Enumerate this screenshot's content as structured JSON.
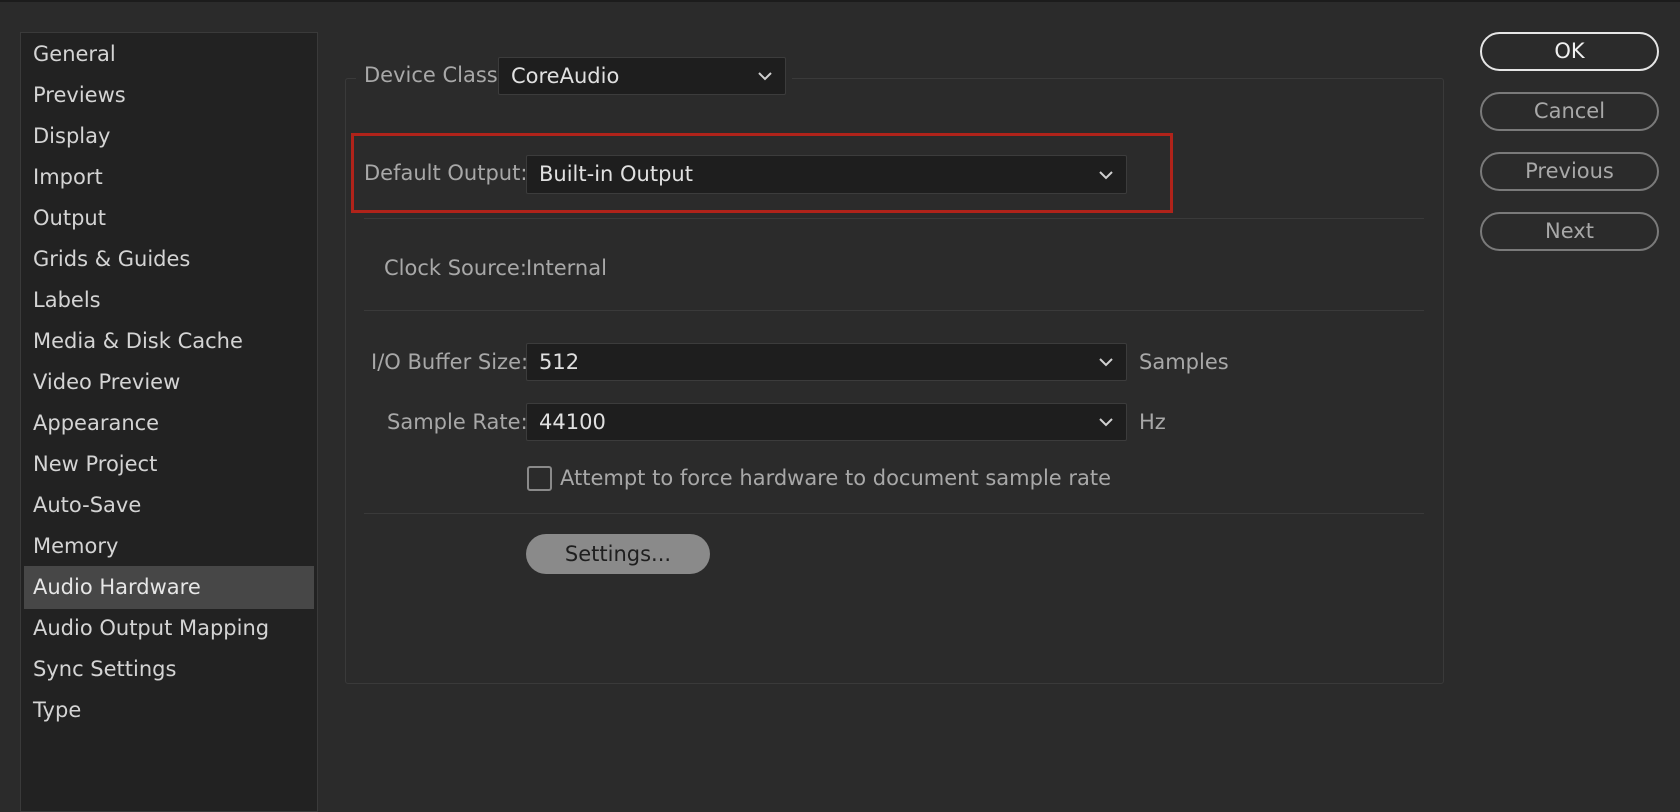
{
  "sidebar": {
    "items": [
      {
        "label": "General"
      },
      {
        "label": "Previews"
      },
      {
        "label": "Display"
      },
      {
        "label": "Import"
      },
      {
        "label": "Output"
      },
      {
        "label": "Grids & Guides"
      },
      {
        "label": "Labels"
      },
      {
        "label": "Media & Disk Cache"
      },
      {
        "label": "Video Preview"
      },
      {
        "label": "Appearance"
      },
      {
        "label": "New Project"
      },
      {
        "label": "Auto-Save"
      },
      {
        "label": "Memory"
      },
      {
        "label": "Audio Hardware",
        "selected": true
      },
      {
        "label": "Audio Output Mapping"
      },
      {
        "label": "Sync Settings"
      },
      {
        "label": "Type"
      }
    ]
  },
  "main": {
    "device_class": {
      "label": "Device Class:",
      "value": "CoreAudio"
    },
    "default_output": {
      "label": "Default Output:",
      "value": "Built-in Output"
    },
    "clock_source": {
      "label": "Clock Source:",
      "value": "Internal"
    },
    "io_buffer": {
      "label": "I/O Buffer Size:",
      "value": "512",
      "unit": "Samples"
    },
    "sample_rate": {
      "label": "Sample Rate:",
      "value": "44100",
      "unit": "Hz"
    },
    "force_rate": {
      "label": "Attempt to force hardware to document sample rate",
      "checked": false
    },
    "settings_button": "Settings..."
  },
  "buttons": {
    "ok": "OK",
    "cancel": "Cancel",
    "previous": "Previous",
    "next": "Next"
  },
  "colors": {
    "background": "#2b2b2b",
    "highlight": "#b0231a",
    "selected_item": "#474747"
  },
  "icons": {
    "dropdown": "chevron-down-icon"
  }
}
